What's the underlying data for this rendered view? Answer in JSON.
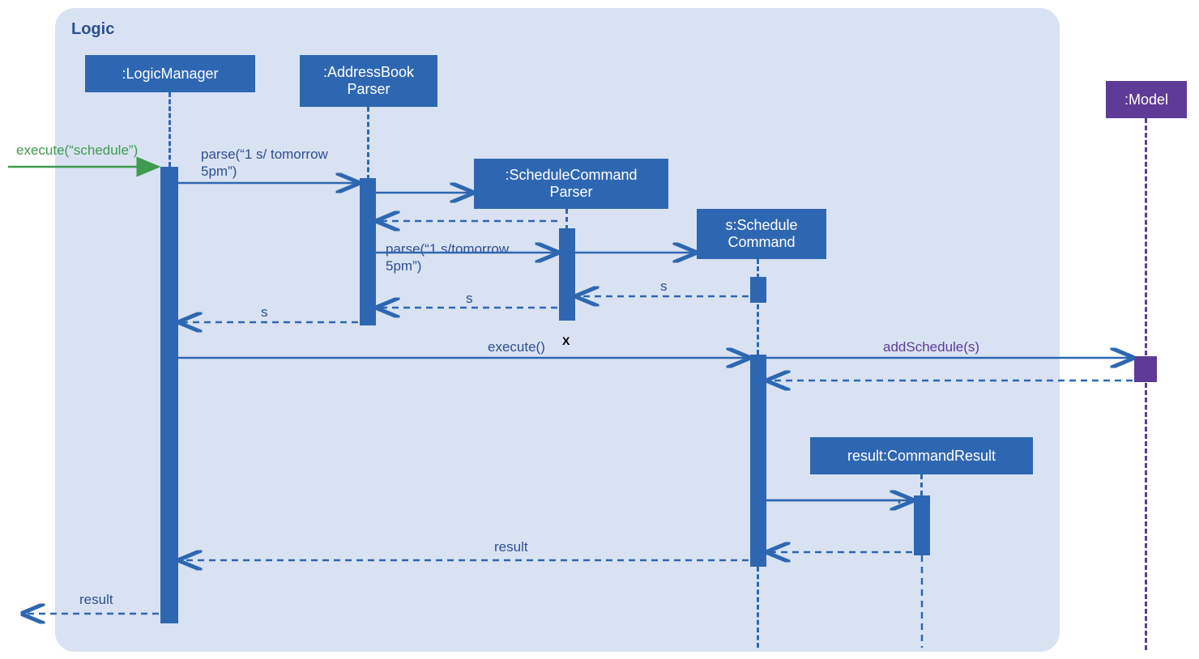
{
  "frame": {
    "title": "Logic"
  },
  "participants": {
    "logicManager": ":LogicManager",
    "addressBookParser": ":AddressBook\nParser",
    "scheduleCommandParser": ":ScheduleCommand\nParser",
    "scheduleCommand": "s:Schedule\nCommand",
    "commandResult": "result:CommandResult",
    "model": ":Model"
  },
  "messages": {
    "entry": "execute(“schedule”)",
    "parse1": "parse(“1 s/ tomorrow\n5pm”)",
    "parse2": "parse(“1 s/tomorrow\n5pm”)",
    "returnS1": "s",
    "returnS2": "s",
    "returnS3": "s",
    "execute2": "execute()",
    "addSchedule": "addSchedule(s)",
    "returnResult1": "result",
    "returnResult2": "result"
  },
  "colors": {
    "blue": "#2e67b1",
    "lightBlue": "#d9e2f2",
    "purple": "#5e3b96",
    "green": "#3e9b4f",
    "darkBlue": "#2d4f8f"
  }
}
